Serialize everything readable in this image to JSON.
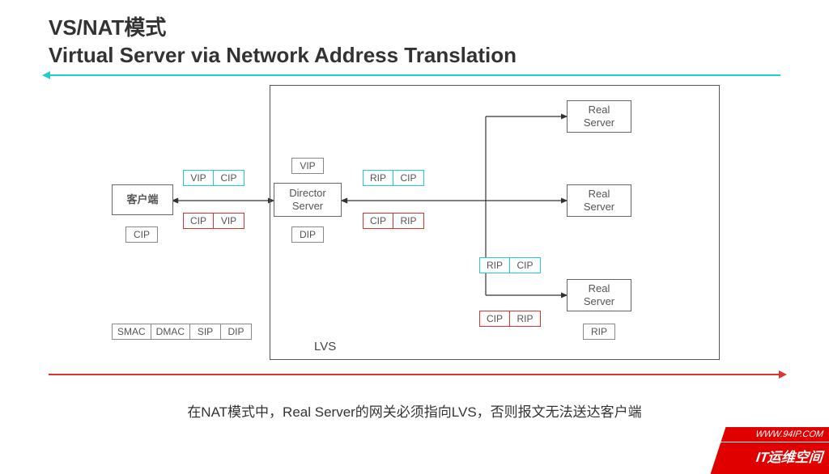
{
  "title_line1": "VS/NAT模式",
  "title_line2": "Virtual Server via Network Address Translation",
  "client_label": "客户端",
  "director_label": "Director\nServer",
  "real_server_label": "Real\nServer",
  "tags": {
    "VIP": "VIP",
    "CIP": "CIP",
    "DIP": "DIP",
    "RIP": "RIP",
    "SMAC": "SMAC",
    "DMAC": "DMAC",
    "SIP": "SIP"
  },
  "lvs_label": "LVS",
  "caption": "在NAT模式中，Real Server的网关必须指向LVS，否则报文无法送达客户端",
  "corner_url": "WWW.94IP.COM",
  "corner_brand": "IT运维空间"
}
